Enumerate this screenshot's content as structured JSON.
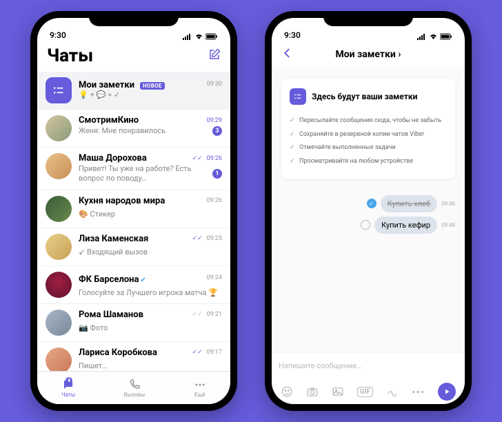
{
  "status": {
    "time": "9:30"
  },
  "phone1": {
    "title": "Чаты",
    "chats": [
      {
        "name": "Мои заметки",
        "new_label": "НОВОЕ",
        "formula": "+ 💬 = ✓",
        "time": "09:30"
      },
      {
        "name": "СмотримКино",
        "preview": "Женя: Мне понравилось",
        "time": "09:29",
        "unread": "3"
      },
      {
        "name": "Маша Дорохова",
        "preview": "Привет! Ты уже на работе? Есть вопрос по поводу…",
        "time": "09:26",
        "unread": "1"
      },
      {
        "name": "Кухня народов мира",
        "preview": "🎨 Стикер",
        "time": "09:26"
      },
      {
        "name": "Лиза Каменская",
        "preview": "↙ Входящий вызов",
        "time": "09:25"
      },
      {
        "name": "ФК Барселона",
        "preview": "Голосуйте за Лучшего игрока матча 🏆",
        "time": "09:24"
      },
      {
        "name": "Рома Шаманов",
        "preview": "📷 Фото",
        "time": "09:21"
      },
      {
        "name": "Лариса Коробкова",
        "preview": "Пишет…",
        "time": "09:17"
      }
    ],
    "nav": {
      "chats": "Чаты",
      "calls": "Вызовы",
      "more": "Ещё",
      "badge": "4"
    }
  },
  "phone2": {
    "title": "Мои заметки",
    "info": {
      "title": "Здесь будут ваши заметки",
      "items": [
        "Пересылайте сообщения сюда, чтобы не забыть",
        "Сохраняйте в резервной копии чатов Viber",
        "Отмечайте выполненные задачи",
        "Просматривайте на любом устройстве"
      ]
    },
    "messages": [
      {
        "text": "Купить хлеб",
        "time": "09:48",
        "done": true
      },
      {
        "text": "Купить кефир",
        "time": "09:48",
        "done": false
      }
    ],
    "composer_placeholder": "Напишите сообщение…"
  }
}
